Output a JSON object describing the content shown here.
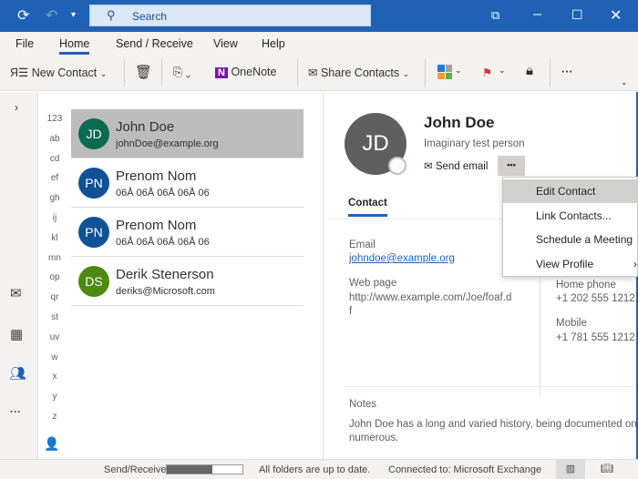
{
  "titlebar": {
    "search_placeholder": "Search",
    "icons": [
      "sync-icon",
      "undo-icon",
      "customize-dropdown-icon",
      "search-icon",
      "restore-window-icon",
      "minimize-icon",
      "maximize-icon",
      "close-icon"
    ]
  },
  "ribbon": {
    "tabs": [
      {
        "label": "File"
      },
      {
        "label": "Home",
        "active": true
      },
      {
        "label": "Send / Receive"
      },
      {
        "label": "View"
      },
      {
        "label": "Help"
      }
    ],
    "tools": {
      "new_contact": "New Contact",
      "onenote": "OneNote",
      "share_contacts": "Share Contacts"
    }
  },
  "alphabet": [
    "123",
    "ab",
    "cd",
    "ef",
    "gh",
    "ij",
    "kl",
    "mn",
    "op",
    "qr",
    "st",
    "uv",
    "w",
    "x",
    "y",
    "z"
  ],
  "contacts": [
    {
      "initials": "JD",
      "name": "John Doe",
      "sub": "johnDoe@example.org",
      "color": "#0b6a53",
      "selected": true
    },
    {
      "initials": "PN",
      "name": "Prenom  Nom",
      "sub": "06Å 06Å 06Å 06Å 06",
      "color": "#0f5296"
    },
    {
      "initials": "PN",
      "name": "Prenom  Nom",
      "sub": "06Å 06Å 06Å 06Å 06",
      "color": "#0f5296"
    },
    {
      "initials": "DS",
      "name": "Derik Stenerson",
      "sub": "deriks@Microsoft.com",
      "color": "#4f8a10"
    }
  ],
  "detail": {
    "initials": "JD",
    "name": "John Doe",
    "subtitle": "Imaginary test person",
    "send_email": "Send email",
    "more": "•••",
    "tab": "Contact",
    "email_label": "Email",
    "email": "johndoe@example.org",
    "web_label": "Web page",
    "web": "http://www.example.com/Joe/foaf.df",
    "home_phone_label": "Home phone",
    "home_phone": "+1 202 555 1212",
    "mobile_label": "Mobile",
    "mobile": "+1 781 555 1212",
    "notes_label": "Notes",
    "notes": "John Doe has a long and varied history, being documented on numerous."
  },
  "menu": [
    {
      "label": "Edit Contact",
      "highlighted": true
    },
    {
      "label": "Link Contacts..."
    },
    {
      "label": "Schedule a Meeting"
    },
    {
      "label": "View Profile",
      "submenu": true
    }
  ],
  "status": {
    "send_receive": "Send/Receive",
    "progress_percent": 60,
    "folders": "All folders are up to date.",
    "connected": "Connected to: Microsoft Exchange"
  },
  "colors": {
    "accent": "#1f62b5",
    "selected_row": "#bcbcbc"
  }
}
